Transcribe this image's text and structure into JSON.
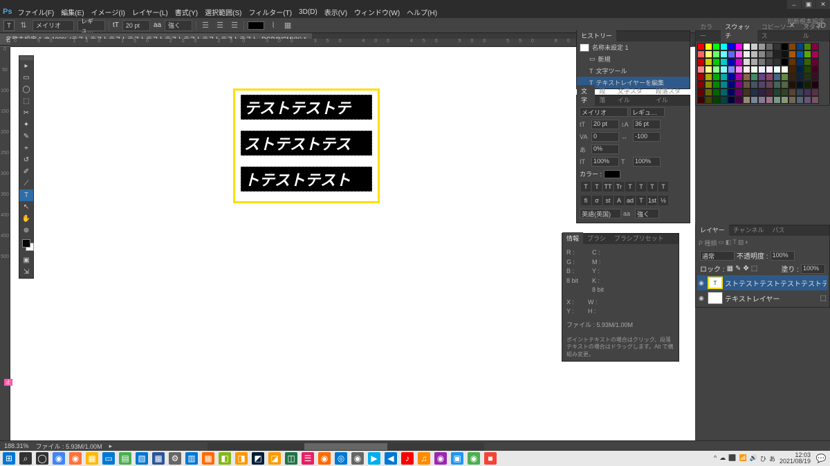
{
  "app": {
    "ps": "Ps"
  },
  "menu": [
    "ファイル(F)",
    "編集(E)",
    "イメージ(I)",
    "レイヤー(L)",
    "書式(Y)",
    "選択範囲(S)",
    "フィルター(T)",
    "3D(D)",
    "表示(V)",
    "ウィンドウ(W)",
    "ヘルプ(H)"
  ],
  "winbtns": {
    "min": "–",
    "max": "▣",
    "close": "✕"
  },
  "optbar": {
    "tool": "T",
    "font": "メイリオ",
    "weight": "レギュ…",
    "size_icon": "tT",
    "size": "20 pt",
    "aa": "aa",
    "sharp": "強く",
    "cancel": "✕",
    "commit": "○",
    "threed": "3D",
    "right": "判断根本設定"
  },
  "doc": {
    "tab": "名称未設定 1 @ 100% (テストテストテストテストテストテストテストテストテストテスト, RGB/8/CMYK) *"
  },
  "ruler_h": "0     50    100   150   200   250   300   350   400   450   500   550   600   650   700   750   800",
  "ruler_v": [
    "0",
    "50",
    "100",
    "150",
    "200",
    "250",
    "300",
    "350",
    "400",
    "450",
    "500"
  ],
  "canvas": {
    "lines": [
      "テストテストテ",
      "ストテストテス",
      "トテストテスト"
    ]
  },
  "tools": [
    "▸",
    "▭",
    "◯",
    "⬚",
    "✂",
    "✦",
    "✎",
    "⌖",
    "↺",
    "✐",
    "⟋",
    "T",
    "↖",
    "✋",
    "⊕"
  ],
  "history": {
    "tab": "ヒストリー",
    "doc": "名称未設定 1",
    "items": [
      {
        "icon": "▭",
        "label": "新規"
      },
      {
        "icon": "T",
        "label": "文字ツール"
      },
      {
        "icon": "T",
        "label": "テキストレイヤーを編集"
      }
    ]
  },
  "char_panel": {
    "tabs": [
      "文字",
      "段落",
      "文字スタイル",
      "段落スタイル"
    ],
    "font": "メイリオ",
    "weight": "レギュ…",
    "size_ic": "tT",
    "size": "20 pt",
    "leading_ic": "↕A",
    "leading": "36 pt",
    "va_ic": "VA",
    "va": "0",
    "tracking_ic": "↔",
    "tracking": "-100",
    "baseline_ic": "あ",
    "baseline": "0%",
    "hscale_ic": "IT",
    "hscale": "100%",
    "vscale_ic": "T",
    "vscale": "100%",
    "color_label": "カラー :",
    "style_btns": [
      "T",
      "T",
      "TT",
      "Tr",
      "T",
      "T",
      "T",
      "T"
    ],
    "ot_btns": [
      "fi",
      "σ",
      "st",
      "A",
      "ad",
      "T",
      "1st",
      "½"
    ],
    "lang": "英語(英国)",
    "aa_ic": "aa",
    "aa": "強く"
  },
  "color_panel": {
    "tabs": [
      "カラー",
      "スウォッチ",
      "コピーソース",
      "スタイル"
    ]
  },
  "info_panel": {
    "tabs": [
      "情報",
      "ブラシ",
      "ブラシプリセット"
    ],
    "r": "R :",
    "g": "G :",
    "b": "B :",
    "bit": "8 bit",
    "c": "C :",
    "y": "Y :",
    "m": "M :",
    "k": "K :",
    "bit2": "8 bit",
    "x": "X :",
    "y2": "Y :",
    "w": "W :",
    "h": "H :",
    "file": "ファイル : 5.93M/1.00M",
    "hint": "ポイントテキストの場合はクリック、段落テキストの場合はドラッグします。Alt で横組み変更。"
  },
  "layers_panel": {
    "tabs": [
      "レイヤー",
      "チャンネル",
      "パス"
    ],
    "kind": "P 種類",
    "blend": "通常",
    "opacity_l": "不透明度 :",
    "opacity": "100%",
    "lock": "ロック :",
    "fill_l": "塗り :",
    "fill": "100%",
    "layers": [
      {
        "thumb": "T",
        "name": "ストテストテストテストテストテストテスト…",
        "active": true,
        "hl": true
      },
      {
        "thumb": "",
        "name": "テキストレイヤー",
        "active": false,
        "lock": "⬚"
      }
    ]
  },
  "status": {
    "zoom": "188.31%",
    "file": "ファイル : 5.93M/1.00M"
  },
  "taskbar": {
    "icons": [
      "⊞",
      "⌕",
      "◯",
      "◉",
      "◉",
      "▦",
      "▭",
      "▤",
      "▧",
      "▦",
      "⚙",
      "▥",
      "▦",
      "◧",
      "◨",
      "◩",
      "◪",
      "◫",
      "☰",
      "◉",
      "◎",
      "◉",
      "▶",
      "◀",
      "♪",
      "♫",
      "◉",
      "▣",
      "◉",
      "■"
    ],
    "sys": [
      "^",
      "☁",
      "⬛",
      "📶",
      "🔊",
      "ひ",
      "あ"
    ],
    "time": "12:03",
    "date": "2021/08/19"
  },
  "swatch_colors": [
    "#f00",
    "#ff0",
    "#0f0",
    "#0ff",
    "#00f",
    "#f0f",
    "#fff",
    "#ccc",
    "#999",
    "#666",
    "#333",
    "#000",
    "#840",
    "#048",
    "#480",
    "#804",
    "#f66",
    "#ff6",
    "#6f6",
    "#6ff",
    "#66f",
    "#f6f",
    "#eee",
    "#bbb",
    "#888",
    "#555",
    "#222",
    "#111",
    "#a50",
    "#05a",
    "#5a0",
    "#a05",
    "#c00",
    "#cc0",
    "#0c0",
    "#0cc",
    "#00c",
    "#c0c",
    "#ddd",
    "#aaa",
    "#777",
    "#444",
    "#333",
    "#000",
    "#630",
    "#036",
    "#360",
    "#603",
    "#f88",
    "#ff8",
    "#8f8",
    "#8ff",
    "#88f",
    "#f8f",
    "#fee",
    "#efe",
    "#eef",
    "#fef",
    "#eff",
    "#ffe",
    "#420",
    "#024",
    "#240",
    "#402",
    "#a00",
    "#aa0",
    "#0a0",
    "#0aa",
    "#00a",
    "#a0a",
    "#864",
    "#486",
    "#648",
    "#846",
    "#468",
    "#684",
    "#321",
    "#123",
    "#231",
    "#312",
    "#800",
    "#880",
    "#080",
    "#088",
    "#008",
    "#808",
    "#654",
    "#456",
    "#546",
    "#645",
    "#465",
    "#564",
    "#210",
    "#012",
    "#120",
    "#201",
    "#600",
    "#660",
    "#060",
    "#066",
    "#006",
    "#606",
    "#432",
    "#234",
    "#324",
    "#423",
    "#243",
    "#342",
    "#543",
    "#345",
    "#435",
    "#534",
    "#400",
    "#440",
    "#040",
    "#044",
    "#004",
    "#404",
    "#987",
    "#789",
    "#879",
    "#978",
    "#798",
    "#897",
    "#765",
    "#567",
    "#657",
    "#756"
  ]
}
